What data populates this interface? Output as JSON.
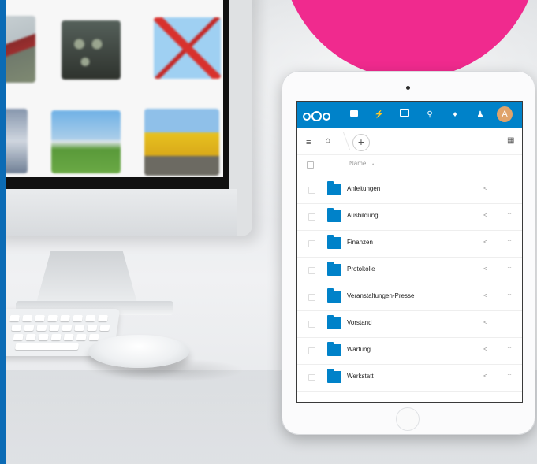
{
  "badge": {
    "text": ""
  },
  "monitor": {
    "thumbnails": [
      {
        "name": "airplane-side",
        "color_a": "#b9c2c6",
        "color_b": "#8a2b2b"
      },
      {
        "name": "cockpit",
        "color_a": "#3b3f3a",
        "color_b": "#6f7a62"
      },
      {
        "name": "red-plane-sky",
        "color_a": "#9fd0f2",
        "color_b": "#d8312d"
      },
      {
        "name": "plane-closeup",
        "color_a": "#6f7f95",
        "color_b": "#cfd6df"
      },
      {
        "name": "airfield",
        "color_a": "#6fb1e6",
        "color_b": "#5a9a3a"
      },
      {
        "name": "yellow-vehicle",
        "color_a": "#8fc0e9",
        "color_b": "#e7c11f"
      }
    ]
  },
  "app": {
    "header": {
      "icons": [
        "nextcloud-logo",
        "folder-icon",
        "activity-icon",
        "gallery-icon",
        "search-icon",
        "notifications-icon",
        "contacts-icon"
      ],
      "avatar_initial": "A"
    },
    "controls": {
      "menu_icon": "≡",
      "home_icon": "⌂",
      "add_label": "+",
      "view_toggle": "▦"
    },
    "list": {
      "column_name": "Name",
      "sort_indicator": "▲",
      "share_icon": "<",
      "more_icon": "···",
      "folders": [
        "Anleitungen",
        "Ausbildung",
        "Finanzen",
        "Protokolle",
        "Veranstaltungen-Presse",
        "Vorstand",
        "Wartung",
        "Werkstatt"
      ]
    }
  },
  "colors": {
    "nextcloud_blue": "#0082c9",
    "pink": "#f02a8e",
    "accent_bar": "#0b6bb5"
  }
}
